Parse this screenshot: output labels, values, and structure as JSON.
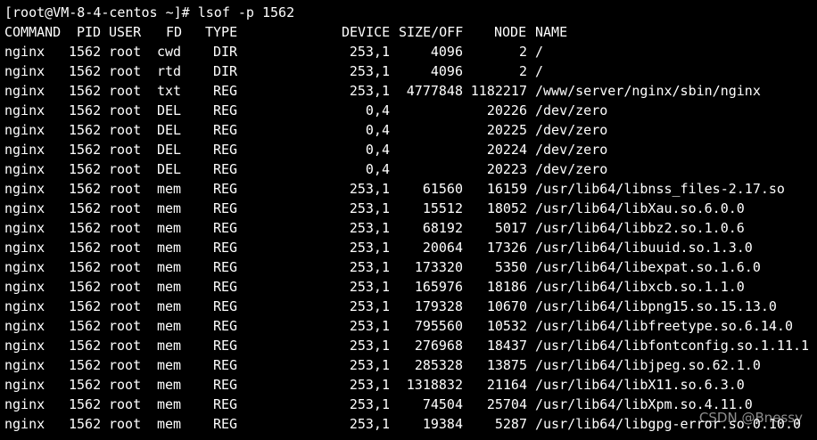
{
  "prompt": {
    "text": "[root@VM-8-4-centos ~]# lsof -p 1562"
  },
  "table": {
    "headers": {
      "command": "COMMAND",
      "pid": "PID",
      "user": "USER",
      "fd": "FD",
      "type": "TYPE",
      "device": "DEVICE",
      "size_off": "SIZE/OFF",
      "node": "NODE",
      "name": "NAME"
    },
    "rows": [
      {
        "command": "nginx",
        "pid": "1562",
        "user": "root",
        "fd": "cwd",
        "type": "DIR",
        "device": "253,1",
        "size_off": "4096",
        "node": "2",
        "name": "/"
      },
      {
        "command": "nginx",
        "pid": "1562",
        "user": "root",
        "fd": "rtd",
        "type": "DIR",
        "device": "253,1",
        "size_off": "4096",
        "node": "2",
        "name": "/"
      },
      {
        "command": "nginx",
        "pid": "1562",
        "user": "root",
        "fd": "txt",
        "type": "REG",
        "device": "253,1",
        "size_off": "4777848",
        "node": "1182217",
        "name": "/www/server/nginx/sbin/nginx"
      },
      {
        "command": "nginx",
        "pid": "1562",
        "user": "root",
        "fd": "DEL",
        "type": "REG",
        "device": "0,4",
        "size_off": "",
        "node": "20226",
        "name": "/dev/zero"
      },
      {
        "command": "nginx",
        "pid": "1562",
        "user": "root",
        "fd": "DEL",
        "type": "REG",
        "device": "0,4",
        "size_off": "",
        "node": "20225",
        "name": "/dev/zero"
      },
      {
        "command": "nginx",
        "pid": "1562",
        "user": "root",
        "fd": "DEL",
        "type": "REG",
        "device": "0,4",
        "size_off": "",
        "node": "20224",
        "name": "/dev/zero"
      },
      {
        "command": "nginx",
        "pid": "1562",
        "user": "root",
        "fd": "DEL",
        "type": "REG",
        "device": "0,4",
        "size_off": "",
        "node": "20223",
        "name": "/dev/zero"
      },
      {
        "command": "nginx",
        "pid": "1562",
        "user": "root",
        "fd": "mem",
        "type": "REG",
        "device": "253,1",
        "size_off": "61560",
        "node": "16159",
        "name": "/usr/lib64/libnss_files-2.17.so"
      },
      {
        "command": "nginx",
        "pid": "1562",
        "user": "root",
        "fd": "mem",
        "type": "REG",
        "device": "253,1",
        "size_off": "15512",
        "node": "18052",
        "name": "/usr/lib64/libXau.so.6.0.0"
      },
      {
        "command": "nginx",
        "pid": "1562",
        "user": "root",
        "fd": "mem",
        "type": "REG",
        "device": "253,1",
        "size_off": "68192",
        "node": "5017",
        "name": "/usr/lib64/libbz2.so.1.0.6"
      },
      {
        "command": "nginx",
        "pid": "1562",
        "user": "root",
        "fd": "mem",
        "type": "REG",
        "device": "253,1",
        "size_off": "20064",
        "node": "17326",
        "name": "/usr/lib64/libuuid.so.1.3.0"
      },
      {
        "command": "nginx",
        "pid": "1562",
        "user": "root",
        "fd": "mem",
        "type": "REG",
        "device": "253,1",
        "size_off": "173320",
        "node": "5350",
        "name": "/usr/lib64/libexpat.so.1.6.0"
      },
      {
        "command": "nginx",
        "pid": "1562",
        "user": "root",
        "fd": "mem",
        "type": "REG",
        "device": "253,1",
        "size_off": "165976",
        "node": "18186",
        "name": "/usr/lib64/libxcb.so.1.1.0"
      },
      {
        "command": "nginx",
        "pid": "1562",
        "user": "root",
        "fd": "mem",
        "type": "REG",
        "device": "253,1",
        "size_off": "179328",
        "node": "10670",
        "name": "/usr/lib64/libpng15.so.15.13.0"
      },
      {
        "command": "nginx",
        "pid": "1562",
        "user": "root",
        "fd": "mem",
        "type": "REG",
        "device": "253,1",
        "size_off": "795560",
        "node": "10532",
        "name": "/usr/lib64/libfreetype.so.6.14.0"
      },
      {
        "command": "nginx",
        "pid": "1562",
        "user": "root",
        "fd": "mem",
        "type": "REG",
        "device": "253,1",
        "size_off": "276968",
        "node": "18437",
        "name": "/usr/lib64/libfontconfig.so.1.11.1"
      },
      {
        "command": "nginx",
        "pid": "1562",
        "user": "root",
        "fd": "mem",
        "type": "REG",
        "device": "253,1",
        "size_off": "285328",
        "node": "13875",
        "name": "/usr/lib64/libjpeg.so.62.1.0"
      },
      {
        "command": "nginx",
        "pid": "1562",
        "user": "root",
        "fd": "mem",
        "type": "REG",
        "device": "253,1",
        "size_off": "1318832",
        "node": "21164",
        "name": "/usr/lib64/libX11.so.6.3.0"
      },
      {
        "command": "nginx",
        "pid": "1562",
        "user": "root",
        "fd": "mem",
        "type": "REG",
        "device": "253,1",
        "size_off": "74504",
        "node": "25704",
        "name": "/usr/lib64/libXpm.so.4.11.0"
      },
      {
        "command": "nginx",
        "pid": "1562",
        "user": "root",
        "fd": "mem",
        "type": "REG",
        "device": "253,1",
        "size_off": "19384",
        "node": "5287",
        "name": "/usr/lib64/libgpg-error.so.0.10.0"
      }
    ]
  },
  "watermark": {
    "text": "CSDN @Bnessy"
  },
  "colors": {
    "background": "#000000",
    "text": "#ffffff"
  }
}
